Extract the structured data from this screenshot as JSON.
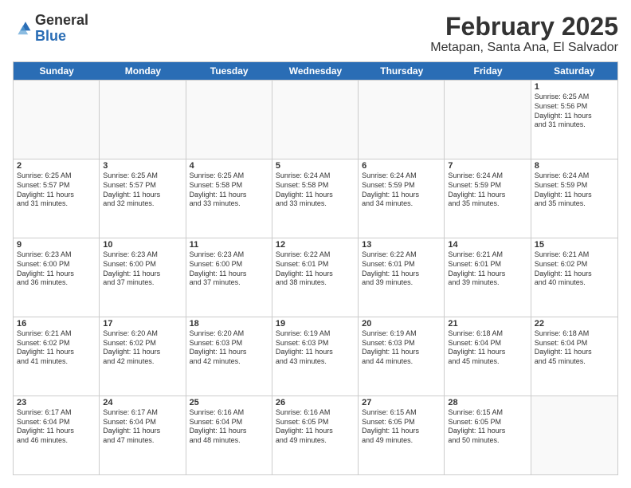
{
  "header": {
    "logo_general": "General",
    "logo_blue": "Blue",
    "title": "February 2025",
    "subtitle": "Metapan, Santa Ana, El Salvador"
  },
  "days_of_week": [
    "Sunday",
    "Monday",
    "Tuesday",
    "Wednesday",
    "Thursday",
    "Friday",
    "Saturday"
  ],
  "weeks": [
    [
      {
        "day": "",
        "info": ""
      },
      {
        "day": "",
        "info": ""
      },
      {
        "day": "",
        "info": ""
      },
      {
        "day": "",
        "info": ""
      },
      {
        "day": "",
        "info": ""
      },
      {
        "day": "",
        "info": ""
      },
      {
        "day": "1",
        "info": "Sunrise: 6:25 AM\nSunset: 5:56 PM\nDaylight: 11 hours\nand 31 minutes."
      }
    ],
    [
      {
        "day": "2",
        "info": "Sunrise: 6:25 AM\nSunset: 5:57 PM\nDaylight: 11 hours\nand 31 minutes."
      },
      {
        "day": "3",
        "info": "Sunrise: 6:25 AM\nSunset: 5:57 PM\nDaylight: 11 hours\nand 32 minutes."
      },
      {
        "day": "4",
        "info": "Sunrise: 6:25 AM\nSunset: 5:58 PM\nDaylight: 11 hours\nand 33 minutes."
      },
      {
        "day": "5",
        "info": "Sunrise: 6:24 AM\nSunset: 5:58 PM\nDaylight: 11 hours\nand 33 minutes."
      },
      {
        "day": "6",
        "info": "Sunrise: 6:24 AM\nSunset: 5:59 PM\nDaylight: 11 hours\nand 34 minutes."
      },
      {
        "day": "7",
        "info": "Sunrise: 6:24 AM\nSunset: 5:59 PM\nDaylight: 11 hours\nand 35 minutes."
      },
      {
        "day": "8",
        "info": "Sunrise: 6:24 AM\nSunset: 5:59 PM\nDaylight: 11 hours\nand 35 minutes."
      }
    ],
    [
      {
        "day": "9",
        "info": "Sunrise: 6:23 AM\nSunset: 6:00 PM\nDaylight: 11 hours\nand 36 minutes."
      },
      {
        "day": "10",
        "info": "Sunrise: 6:23 AM\nSunset: 6:00 PM\nDaylight: 11 hours\nand 37 minutes."
      },
      {
        "day": "11",
        "info": "Sunrise: 6:23 AM\nSunset: 6:00 PM\nDaylight: 11 hours\nand 37 minutes."
      },
      {
        "day": "12",
        "info": "Sunrise: 6:22 AM\nSunset: 6:01 PM\nDaylight: 11 hours\nand 38 minutes."
      },
      {
        "day": "13",
        "info": "Sunrise: 6:22 AM\nSunset: 6:01 PM\nDaylight: 11 hours\nand 39 minutes."
      },
      {
        "day": "14",
        "info": "Sunrise: 6:21 AM\nSunset: 6:01 PM\nDaylight: 11 hours\nand 39 minutes."
      },
      {
        "day": "15",
        "info": "Sunrise: 6:21 AM\nSunset: 6:02 PM\nDaylight: 11 hours\nand 40 minutes."
      }
    ],
    [
      {
        "day": "16",
        "info": "Sunrise: 6:21 AM\nSunset: 6:02 PM\nDaylight: 11 hours\nand 41 minutes."
      },
      {
        "day": "17",
        "info": "Sunrise: 6:20 AM\nSunset: 6:02 PM\nDaylight: 11 hours\nand 42 minutes."
      },
      {
        "day": "18",
        "info": "Sunrise: 6:20 AM\nSunset: 6:03 PM\nDaylight: 11 hours\nand 42 minutes."
      },
      {
        "day": "19",
        "info": "Sunrise: 6:19 AM\nSunset: 6:03 PM\nDaylight: 11 hours\nand 43 minutes."
      },
      {
        "day": "20",
        "info": "Sunrise: 6:19 AM\nSunset: 6:03 PM\nDaylight: 11 hours\nand 44 minutes."
      },
      {
        "day": "21",
        "info": "Sunrise: 6:18 AM\nSunset: 6:04 PM\nDaylight: 11 hours\nand 45 minutes."
      },
      {
        "day": "22",
        "info": "Sunrise: 6:18 AM\nSunset: 6:04 PM\nDaylight: 11 hours\nand 45 minutes."
      }
    ],
    [
      {
        "day": "23",
        "info": "Sunrise: 6:17 AM\nSunset: 6:04 PM\nDaylight: 11 hours\nand 46 minutes."
      },
      {
        "day": "24",
        "info": "Sunrise: 6:17 AM\nSunset: 6:04 PM\nDaylight: 11 hours\nand 47 minutes."
      },
      {
        "day": "25",
        "info": "Sunrise: 6:16 AM\nSunset: 6:04 PM\nDaylight: 11 hours\nand 48 minutes."
      },
      {
        "day": "26",
        "info": "Sunrise: 6:16 AM\nSunset: 6:05 PM\nDaylight: 11 hours\nand 49 minutes."
      },
      {
        "day": "27",
        "info": "Sunrise: 6:15 AM\nSunset: 6:05 PM\nDaylight: 11 hours\nand 49 minutes."
      },
      {
        "day": "28",
        "info": "Sunrise: 6:15 AM\nSunset: 6:05 PM\nDaylight: 11 hours\nand 50 minutes."
      },
      {
        "day": "",
        "info": ""
      }
    ]
  ]
}
